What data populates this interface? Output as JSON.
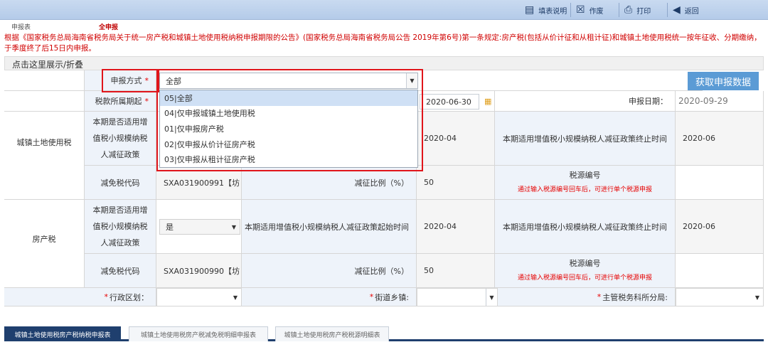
{
  "toolbar": {
    "instructions_label": "填表说明",
    "void_label": "作废",
    "print_label": "打印",
    "back_label": "返回"
  },
  "tabs": {
    "report_label": "申报表",
    "all_report_label": "全申报"
  },
  "notice": "根据《国家税务总局海南省税务局关于统一房产税和城镇土地使用税纳税申报期限的公告》(国家税务总局海南省税务局公告 2019年第6号)第一条规定:房产税(包括从价计征和从租计征)和城镇土地使用税统一按年征收、分期缴纳，于季度终了后15日内申报。",
  "collapse_label": "点击这里展示/折叠",
  "form": {
    "declare_method_label": "申报方式",
    "declare_method_value": "全部",
    "fetch_button": "获取申报数据",
    "period_label": "税款所属期起",
    "period_end_value": "2020-06-30",
    "declare_date_label": "申报日期：",
    "declare_date_value": "2020-09-29",
    "options": [
      "05|全部",
      "04|仅申报城镇土地使用税",
      "01|仅申报房产税",
      "02|仅申报从价计征房产税",
      "03|仅申报从租计征房产税"
    ],
    "land_tax_label": "城镇土地使用税",
    "house_tax_label": "房产税",
    "small_scale_line1": "本期是否适用增",
    "small_scale_line2": "值税小规模纳税",
    "small_scale_line3": "人减征政策",
    "small_scale_value": "是",
    "policy_start_label": "本期适用增值税小规模纳税人减征政策起始时间",
    "policy_start_value": "2020-04",
    "policy_end_label": "本期适用增值税小规模纳税人减征政策终止时间",
    "policy_end_value": "2020-06",
    "exempt_code_label": "减免税代码",
    "land_exempt_code": "SXA031900991【坊",
    "house_exempt_code": "SXA031900990【坊",
    "reduce_ratio_label": "减征比例（%）",
    "reduce_ratio_value": "50",
    "tax_source_label": "税源编号",
    "tax_source_hint": "通过输入税源编号回车后，可进行单个税源申报",
    "region_label": "行政区划：",
    "street_label": "街道乡镇:",
    "tax_office_label": "主管税务科所分局:"
  },
  "bottom_tabs": [
    "城镇土地使用税房产税纳税申报表",
    "城镇土地使用税房产税减免税明细申报表",
    "城镇土地使用税房产税税源明细表"
  ],
  "colors": {
    "accent": "#5b9bd5",
    "highlight": "#e0151b",
    "tab_active": "#1f3f6e"
  }
}
